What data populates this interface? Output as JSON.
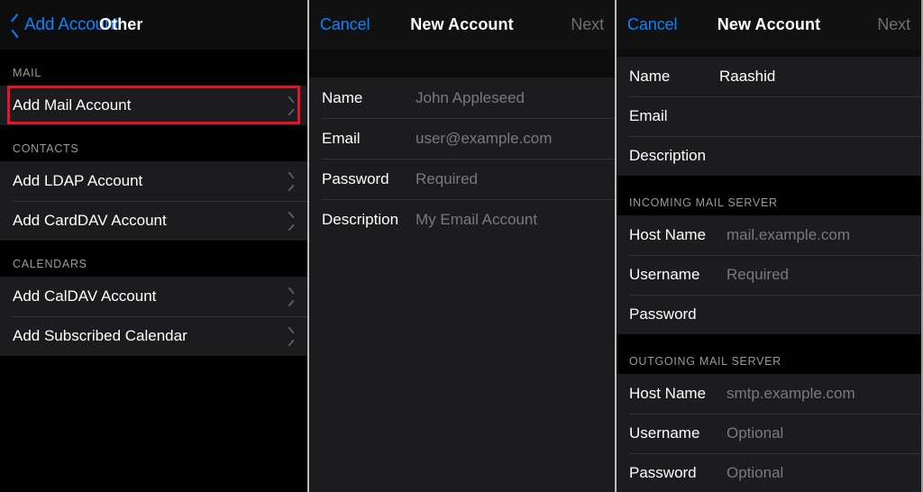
{
  "panels": {
    "left": {
      "nav": {
        "back_label": "Add Account",
        "title": "Other",
        "back_icon": "chevron-left-icon"
      },
      "sections": [
        {
          "header": "MAIL",
          "rows": [
            {
              "label": "Add Mail Account",
              "accessory": "chevron-right-icon",
              "highlighted": true
            }
          ]
        },
        {
          "header": "CONTACTS",
          "rows": [
            {
              "label": "Add LDAP Account",
              "accessory": "chevron-right-icon"
            },
            {
              "label": "Add CardDAV Account",
              "accessory": "chevron-right-icon"
            }
          ]
        },
        {
          "header": "CALENDARS",
          "rows": [
            {
              "label": "Add CalDAV Account",
              "accessory": "chevron-right-icon"
            },
            {
              "label": "Add Subscribed Calendar",
              "accessory": "chevron-right-icon"
            }
          ]
        }
      ]
    },
    "middle": {
      "nav": {
        "cancel_label": "Cancel",
        "title": "New Account",
        "next_label": "Next"
      },
      "fields": [
        {
          "label": "Name",
          "value": "",
          "placeholder": "John Appleseed"
        },
        {
          "label": "Email",
          "value": "",
          "placeholder": "user@example.com"
        },
        {
          "label": "Password",
          "value": "",
          "placeholder": "Required"
        },
        {
          "label": "Description",
          "value": "",
          "placeholder": "My Email Account"
        }
      ]
    },
    "right": {
      "nav": {
        "cancel_label": "Cancel",
        "title": "New Account",
        "next_label": "Next"
      },
      "account_fields": [
        {
          "label": "Name",
          "value": "Raashid",
          "placeholder": ""
        },
        {
          "label": "Email",
          "value": "",
          "placeholder": ""
        },
        {
          "label": "Description",
          "value": "",
          "placeholder": ""
        }
      ],
      "incoming": {
        "header": "INCOMING MAIL SERVER",
        "fields": [
          {
            "label": "Host Name",
            "value": "",
            "placeholder": "mail.example.com"
          },
          {
            "label": "Username",
            "value": "",
            "placeholder": "Required"
          },
          {
            "label": "Password",
            "value": "",
            "placeholder": ""
          }
        ]
      },
      "outgoing": {
        "header": "OUTGOING MAIL SERVER",
        "fields": [
          {
            "label": "Host Name",
            "value": "",
            "placeholder": "smtp.example.com"
          },
          {
            "label": "Username",
            "value": "",
            "placeholder": "Optional"
          },
          {
            "label": "Password",
            "value": "",
            "placeholder": "Optional"
          }
        ]
      }
    }
  },
  "colors": {
    "accent_blue": "#0a84ff",
    "highlight_red": "#e8132b",
    "row_background": "#1c1c1e",
    "page_background": "#000000",
    "placeholder_text": "#7a7a7d",
    "disabled_text": "#6f6f6f"
  }
}
